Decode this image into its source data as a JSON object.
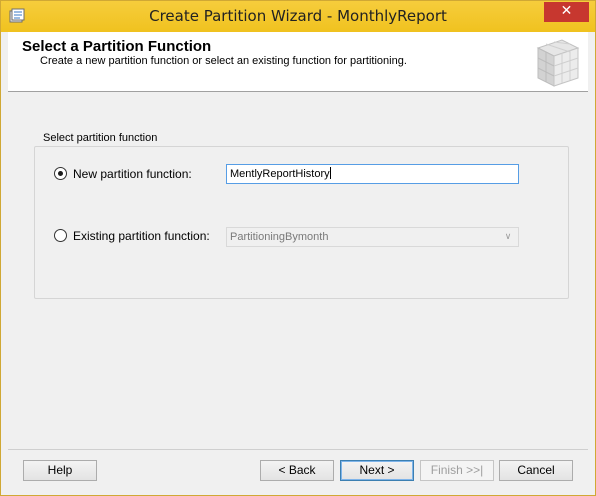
{
  "window": {
    "title": "Create Partition Wizard - MonthlyReport",
    "close_glyph": "✕"
  },
  "header": {
    "title": "Select a Partition Function",
    "description": "Create a new partition function or select an existing function for partitioning."
  },
  "group": {
    "label": "Select partition function",
    "new_function": {
      "label": "New partition function:",
      "selected": true,
      "value": "MentlyReportHistory"
    },
    "existing_function": {
      "label": "Existing partition function:",
      "selected": false,
      "value": "PartitioningBymonth",
      "arrow_glyph": "∨"
    }
  },
  "buttons": {
    "help": "Help",
    "back": "< Back",
    "next": "Next >",
    "finish": "Finish >>|",
    "cancel": "Cancel"
  },
  "colors": {
    "title_bar": "#f0c21f",
    "close_button": "#c7372f",
    "focus_border": "#569de5"
  },
  "icons": {
    "app": "sql-server-wizard-icon",
    "header_graphic": "partition-cube-icon"
  }
}
